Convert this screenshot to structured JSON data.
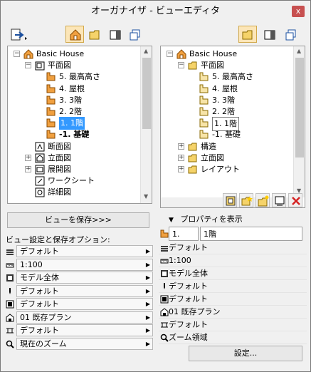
{
  "window": {
    "title": "オーガナイザ - ビューエディタ",
    "close_label": "x"
  },
  "left": {
    "tree": [
      {
        "label": "Basic House",
        "icon": "house-icon",
        "indent": 0,
        "expander": "−"
      },
      {
        "label": "平面図",
        "icon": "floorplan-folder-icon",
        "indent": 1,
        "expander": "−"
      },
      {
        "label": "5. 最高高さ",
        "icon": "story-icon",
        "indent": 2
      },
      {
        "label": "4. 屋根",
        "icon": "story-icon",
        "indent": 2
      },
      {
        "label": "3. 3階",
        "icon": "story-icon",
        "indent": 2
      },
      {
        "label": "2. 2階",
        "icon": "story-icon",
        "indent": 2
      },
      {
        "label": "1. 1階",
        "icon": "story-icon",
        "indent": 2,
        "selected": true
      },
      {
        "label": "-1. 基礎",
        "icon": "story-icon",
        "indent": 2,
        "bold": true
      },
      {
        "label": "断面図",
        "icon": "section-icon",
        "indent": 1
      },
      {
        "label": "立面図",
        "icon": "elevation-icon",
        "indent": 1,
        "expander": "+"
      },
      {
        "label": "展開図",
        "icon": "interior-elevation-icon",
        "indent": 1,
        "expander": "+"
      },
      {
        "label": "ワークシート",
        "icon": "worksheet-icon",
        "indent": 1
      },
      {
        "label": "詳細図",
        "icon": "detail-icon",
        "indent": 1
      }
    ],
    "save_view_label": "ビューを保存>>>",
    "options_heading": "ビュー設定と保存オプション:",
    "options": [
      {
        "icon": "layer-combination-icon",
        "value": "デフォルト"
      },
      {
        "icon": "scale-icon",
        "value": "1:100"
      },
      {
        "icon": "structure-display-icon",
        "value": "モデル全体"
      },
      {
        "icon": "pen-set-icon",
        "value": "デフォルト"
      },
      {
        "icon": "model-view-option-icon",
        "value": "デフォルト"
      },
      {
        "icon": "renovation-filter-icon",
        "value": "01 既存プラン"
      },
      {
        "icon": "dimension-icon",
        "value": "デフォルト"
      },
      {
        "icon": "zoom-icon",
        "value": "現在のズーム"
      }
    ]
  },
  "right": {
    "tree": [
      {
        "label": "Basic House",
        "icon": "house-icon",
        "indent": 0,
        "expander": "−"
      },
      {
        "label": "平面図",
        "icon": "folder-icon",
        "indent": 1,
        "expander": "−"
      },
      {
        "label": "5. 最高高さ",
        "icon": "view-icon",
        "indent": 2
      },
      {
        "label": "4. 屋根",
        "icon": "view-icon",
        "indent": 2
      },
      {
        "label": "3. 3階",
        "icon": "view-icon",
        "indent": 2
      },
      {
        "label": "2. 2階",
        "icon": "view-icon",
        "indent": 2
      },
      {
        "label": "1. 1階",
        "icon": "view-icon",
        "indent": 2,
        "boxed": true
      },
      {
        "label": "-1. 基礎",
        "icon": "view-icon",
        "indent": 2
      },
      {
        "label": "構造",
        "icon": "folder-icon",
        "indent": 1,
        "expander": "+"
      },
      {
        "label": "立面図",
        "icon": "folder-icon",
        "indent": 1,
        "expander": "+"
      },
      {
        "label": "レイアウト",
        "icon": "folder-icon",
        "indent": 1,
        "expander": "+"
      }
    ],
    "properties_label": "プロパティを表示",
    "id_value": "1.",
    "name_value": "1階",
    "props": [
      {
        "icon": "layer-combination-icon",
        "value": "デフォルト"
      },
      {
        "icon": "scale-icon",
        "value": "1:100"
      },
      {
        "icon": "structure-display-icon",
        "value": "モデル全体"
      },
      {
        "icon": "pen-set-icon",
        "value": "デフォルト"
      },
      {
        "icon": "model-view-option-icon",
        "value": "デフォルト"
      },
      {
        "icon": "renovation-filter-icon",
        "value": "01 既存プラン"
      },
      {
        "icon": "dimension-icon",
        "value": "デフォルト"
      },
      {
        "icon": "zoom-icon",
        "value": "ズーム領域"
      }
    ],
    "settings_label": "設定..."
  },
  "colors": {
    "accent": "#3399ff",
    "story": "#f0a040",
    "folder": "#f5d36a",
    "delete": "#d42020"
  }
}
